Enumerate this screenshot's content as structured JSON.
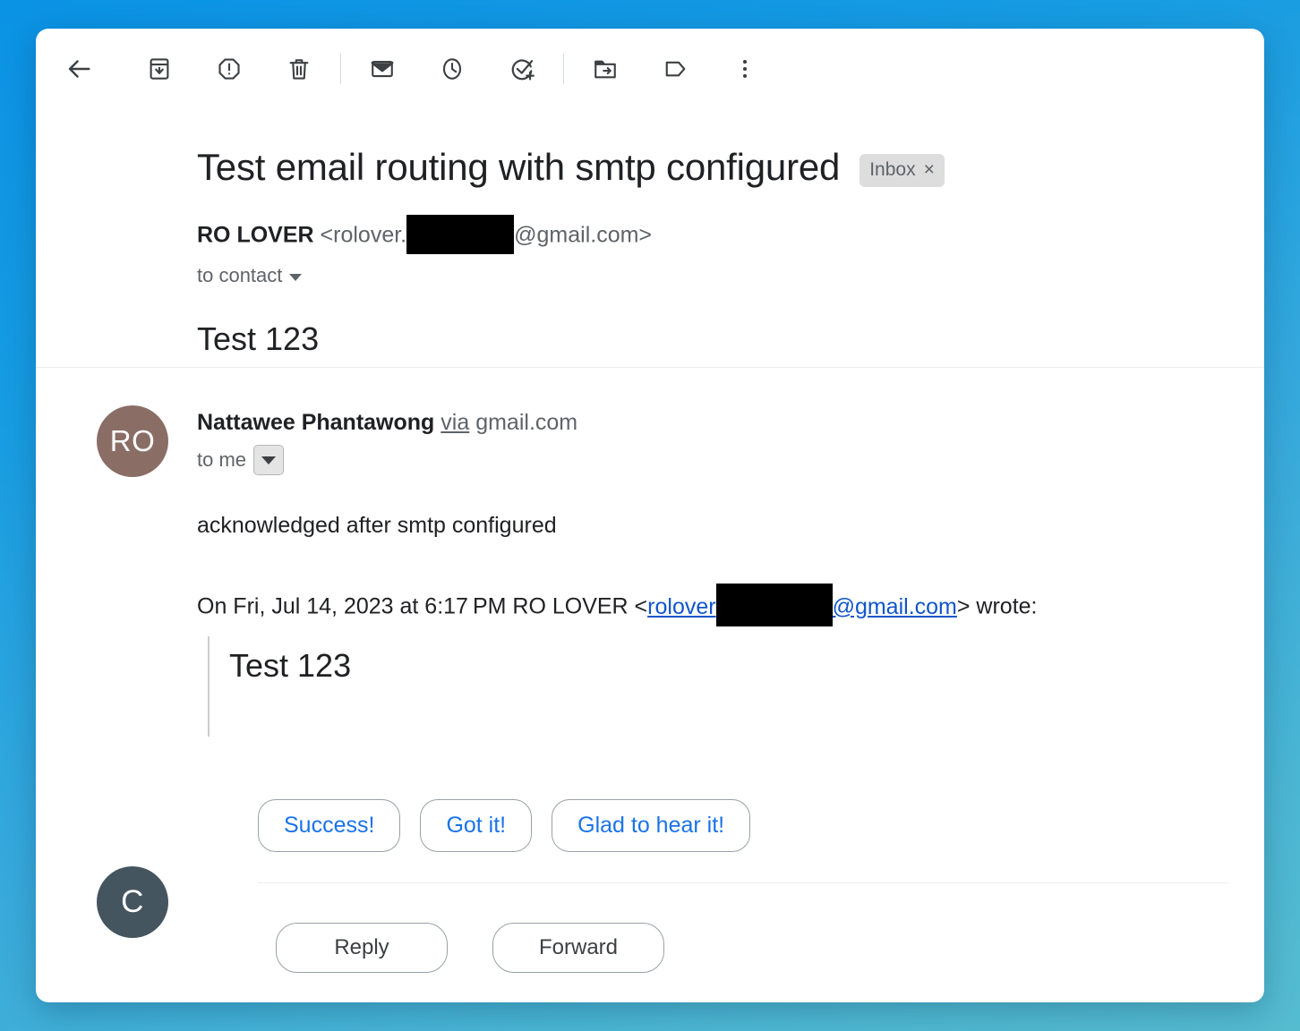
{
  "toolbar": {
    "buttons": [
      {
        "name": "back-arrow-icon",
        "label": "Back"
      },
      {
        "name": "archive-icon",
        "label": "Archive"
      },
      {
        "name": "report-spam-icon",
        "label": "Report spam"
      },
      {
        "name": "delete-icon",
        "label": "Delete"
      },
      {
        "name": "mark-unread-icon",
        "label": "Mark as unread"
      },
      {
        "name": "snooze-clock-icon",
        "label": "Snooze"
      },
      {
        "name": "add-to-tasks-icon",
        "label": "Add to tasks"
      },
      {
        "name": "move-to-folder-icon",
        "label": "Move to"
      },
      {
        "name": "label-tag-icon",
        "label": "Labels"
      },
      {
        "name": "more-options-icon",
        "label": "More"
      }
    ]
  },
  "subject": {
    "title": "Test email routing with smtp configured",
    "label_chip": "Inbox",
    "label_chip_remove": "×"
  },
  "messages": [
    {
      "avatar_initials": "RO",
      "avatar_color": "#8a6e66",
      "sender_name": "RO LOVER",
      "email_prefix": "<rolover.",
      "email_suffix": "@gmail.com>",
      "recipient": "to contact",
      "body": "Test 123"
    },
    {
      "avatar_initials": "C",
      "avatar_color": "#44555f",
      "sender_name": "Nattawee Phantawong",
      "via_word": "via",
      "via_domain": "gmail.com",
      "recipient": "to me",
      "body": "acknowledged after smtp configured",
      "quote_header_prefix": "On Fri, Jul 14, 2023 at 6:17 PM RO LOVER <",
      "quote_link_prefix": "rolover",
      "quote_link_suffix": "@gmail.com",
      "quote_header_suffix": "> wrote:",
      "quoted_body": "Test 123"
    }
  ],
  "smart_replies": [
    "Success!",
    "Got it!",
    "Glad to hear it!"
  ],
  "footer_actions": [
    "Reply",
    "Forward"
  ],
  "colors": {
    "link_blue": "#1155cc",
    "action_blue": "#1a73e8",
    "text_primary": "#202124",
    "text_secondary": "#5f6368",
    "background_top": "#0a92e4",
    "background_bottom": "#55bcd0"
  }
}
